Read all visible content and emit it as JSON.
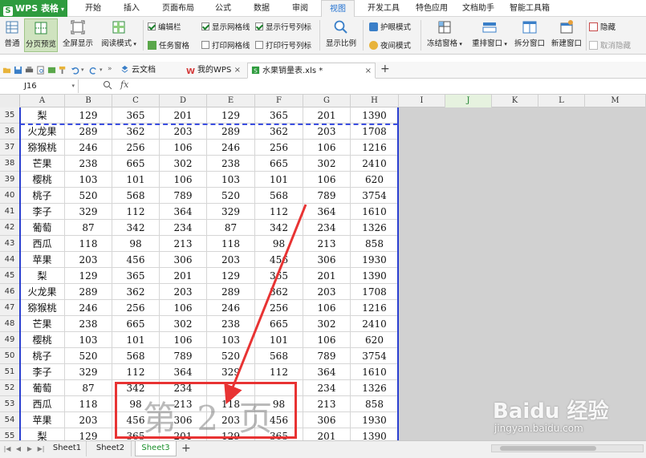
{
  "app": {
    "name": "WPS 表格"
  },
  "menu": [
    "开始",
    "插入",
    "页面布局",
    "公式",
    "数据",
    "审阅",
    "视图",
    "开发工具",
    "特色应用",
    "文档助手",
    "智能工具箱"
  ],
  "menu_active": "视图",
  "ribbon": {
    "normal": "普通",
    "page_break_preview": "分页预览",
    "full_screen": "全屏显示",
    "reading_mode": "阅读模式",
    "edit_bar": "编辑栏",
    "task_pane": "任务窗格",
    "show_gridlines": "显示网格线",
    "print_gridlines": "打印网格线",
    "show_headers": "显示行号列标",
    "print_headers": "打印行号列标",
    "zoom": "显示比例",
    "eye_protection": "护眼模式",
    "night_mode": "夜间模式",
    "freeze_panes": "冻结窗格",
    "rearrange_windows": "重排窗口",
    "split_window": "拆分窗口",
    "new_window": "新建窗口",
    "hide": "隐藏",
    "unhide": "取消隐藏"
  },
  "doc_tabs": [
    "云文档",
    "我的WPS",
    "水果销量表.xls *"
  ],
  "formula_bar": {
    "cell_ref": "J16",
    "fx": "fx"
  },
  "columns": [
    "A",
    "B",
    "C",
    "D",
    "E",
    "F",
    "G",
    "H",
    "I",
    "J",
    "K",
    "L",
    "M"
  ],
  "active_column": "J",
  "rows": [
    {
      "n": "35",
      "cells": [
        "梨",
        "129",
        "365",
        "201",
        "129",
        "365",
        "201",
        "1390"
      ]
    },
    {
      "n": "36",
      "cells": [
        "火龙果",
        "289",
        "362",
        "203",
        "289",
        "362",
        "203",
        "1708"
      ]
    },
    {
      "n": "37",
      "cells": [
        "猕猴桃",
        "246",
        "256",
        "106",
        "246",
        "256",
        "106",
        "1216"
      ]
    },
    {
      "n": "38",
      "cells": [
        "芒果",
        "238",
        "665",
        "302",
        "238",
        "665",
        "302",
        "2410"
      ]
    },
    {
      "n": "39",
      "cells": [
        "樱桃",
        "103",
        "101",
        "106",
        "103",
        "101",
        "106",
        "620"
      ]
    },
    {
      "n": "40",
      "cells": [
        "桃子",
        "520",
        "568",
        "789",
        "520",
        "568",
        "789",
        "3754"
      ]
    },
    {
      "n": "41",
      "cells": [
        "李子",
        "329",
        "112",
        "364",
        "329",
        "112",
        "364",
        "1610"
      ]
    },
    {
      "n": "42",
      "cells": [
        "葡萄",
        "87",
        "342",
        "234",
        "87",
        "342",
        "234",
        "1326"
      ]
    },
    {
      "n": "43",
      "cells": [
        "西瓜",
        "118",
        "98",
        "213",
        "118",
        "98",
        "213",
        "858"
      ]
    },
    {
      "n": "44",
      "cells": [
        "苹果",
        "203",
        "456",
        "306",
        "203",
        "456",
        "306",
        "1930"
      ]
    },
    {
      "n": "45",
      "cells": [
        "梨",
        "129",
        "365",
        "201",
        "129",
        "365",
        "201",
        "1390"
      ]
    },
    {
      "n": "46",
      "cells": [
        "火龙果",
        "289",
        "362",
        "203",
        "289",
        "362",
        "203",
        "1708"
      ]
    },
    {
      "n": "47",
      "cells": [
        "猕猴桃",
        "246",
        "256",
        "106",
        "246",
        "256",
        "106",
        "1216"
      ]
    },
    {
      "n": "48",
      "cells": [
        "芒果",
        "238",
        "665",
        "302",
        "238",
        "665",
        "302",
        "2410"
      ]
    },
    {
      "n": "49",
      "cells": [
        "樱桃",
        "103",
        "101",
        "106",
        "103",
        "101",
        "106",
        "620"
      ]
    },
    {
      "n": "50",
      "cells": [
        "桃子",
        "520",
        "568",
        "789",
        "520",
        "568",
        "789",
        "3754"
      ]
    },
    {
      "n": "51",
      "cells": [
        "李子",
        "329",
        "112",
        "364",
        "329",
        "112",
        "364",
        "1610"
      ]
    },
    {
      "n": "52",
      "cells": [
        "葡萄",
        "87",
        "342",
        "234",
        "",
        "",
        "234",
        "1326"
      ]
    },
    {
      "n": "53",
      "cells": [
        "西瓜",
        "118",
        "98",
        "213",
        "118",
        "98",
        "213",
        "858"
      ]
    },
    {
      "n": "54",
      "cells": [
        "苹果",
        "203",
        "456",
        "306",
        "203",
        "456",
        "306",
        "1930"
      ]
    },
    {
      "n": "55",
      "cells": [
        "梨",
        "129",
        "365",
        "201",
        "129",
        "365",
        "201",
        "1390"
      ]
    }
  ],
  "page_watermark": "第 2 页",
  "sheets": [
    "Sheet1",
    "Sheet2",
    "Sheet3"
  ],
  "active_sheet": "Sheet3",
  "watermark_baidu": {
    "brand": "Baidu 经验",
    "url": "jingyan.baidu.com"
  },
  "colors": {
    "app_green": "#2e9b3e",
    "page_border": "#2a3fd0",
    "highlight": "#e83333"
  }
}
